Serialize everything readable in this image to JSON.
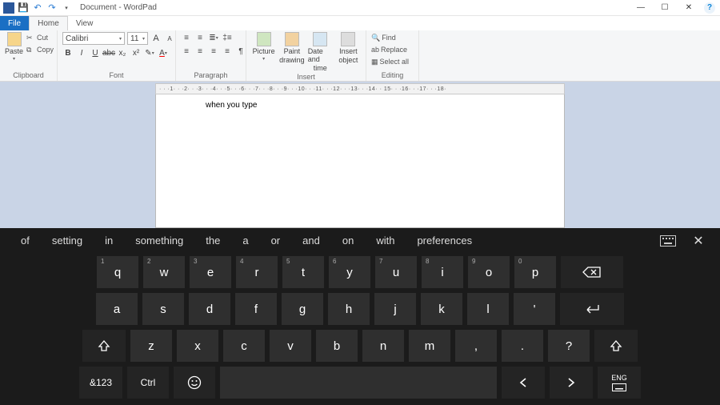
{
  "title": "Document - WordPad",
  "tabs": {
    "file": "File",
    "home": "Home",
    "view": "View"
  },
  "ribbon": {
    "clipboard": {
      "paste": "Paste",
      "cut": "Cut",
      "copy": "Copy",
      "label": "Clipboard"
    },
    "font": {
      "name": "Calibri",
      "size": "11",
      "label": "Font"
    },
    "paragraph": {
      "label": "Paragraph"
    },
    "insert": {
      "picture": "Picture",
      "paint": "Paint\ndrawing",
      "paint1": "Paint",
      "paint2": "drawing",
      "date1": "Date and",
      "date2": "time",
      "object1": "Insert",
      "object2": "object",
      "label": "Insert"
    },
    "editing": {
      "find": "Find",
      "replace": "Replace",
      "selectall": "Select all",
      "label": "Editing"
    }
  },
  "ruler": "· · ·1· · ·2· · ·3· · ·4· · ·5· · ·6· · ·7· · ·8· · ·9· · ·10· · ·11· · ·12· · ·13· · ·14· · 15· · ·16· · ·17· · ·18·",
  "document": {
    "text": "when you type"
  },
  "suggestions": [
    "of",
    "setting",
    "in",
    "something",
    "the",
    "a",
    "or",
    "and",
    "on",
    "with",
    "preferences"
  ],
  "keys": {
    "row1": [
      {
        "l": "q",
        "n": "1"
      },
      {
        "l": "w",
        "n": "2"
      },
      {
        "l": "e",
        "n": "3"
      },
      {
        "l": "r",
        "n": "4"
      },
      {
        "l": "t",
        "n": "5"
      },
      {
        "l": "y",
        "n": "6"
      },
      {
        "l": "u",
        "n": "7"
      },
      {
        "l": "i",
        "n": "8"
      },
      {
        "l": "o",
        "n": "9"
      },
      {
        "l": "p",
        "n": "0"
      }
    ],
    "row2": [
      "a",
      "s",
      "d",
      "f",
      "g",
      "h",
      "j",
      "k",
      "l",
      "'"
    ],
    "row3": [
      "z",
      "x",
      "c",
      "v",
      "b",
      "n",
      "m",
      ",",
      ".",
      "?"
    ],
    "mode": "&123",
    "ctrl": "Ctrl",
    "lang": "ENG"
  }
}
